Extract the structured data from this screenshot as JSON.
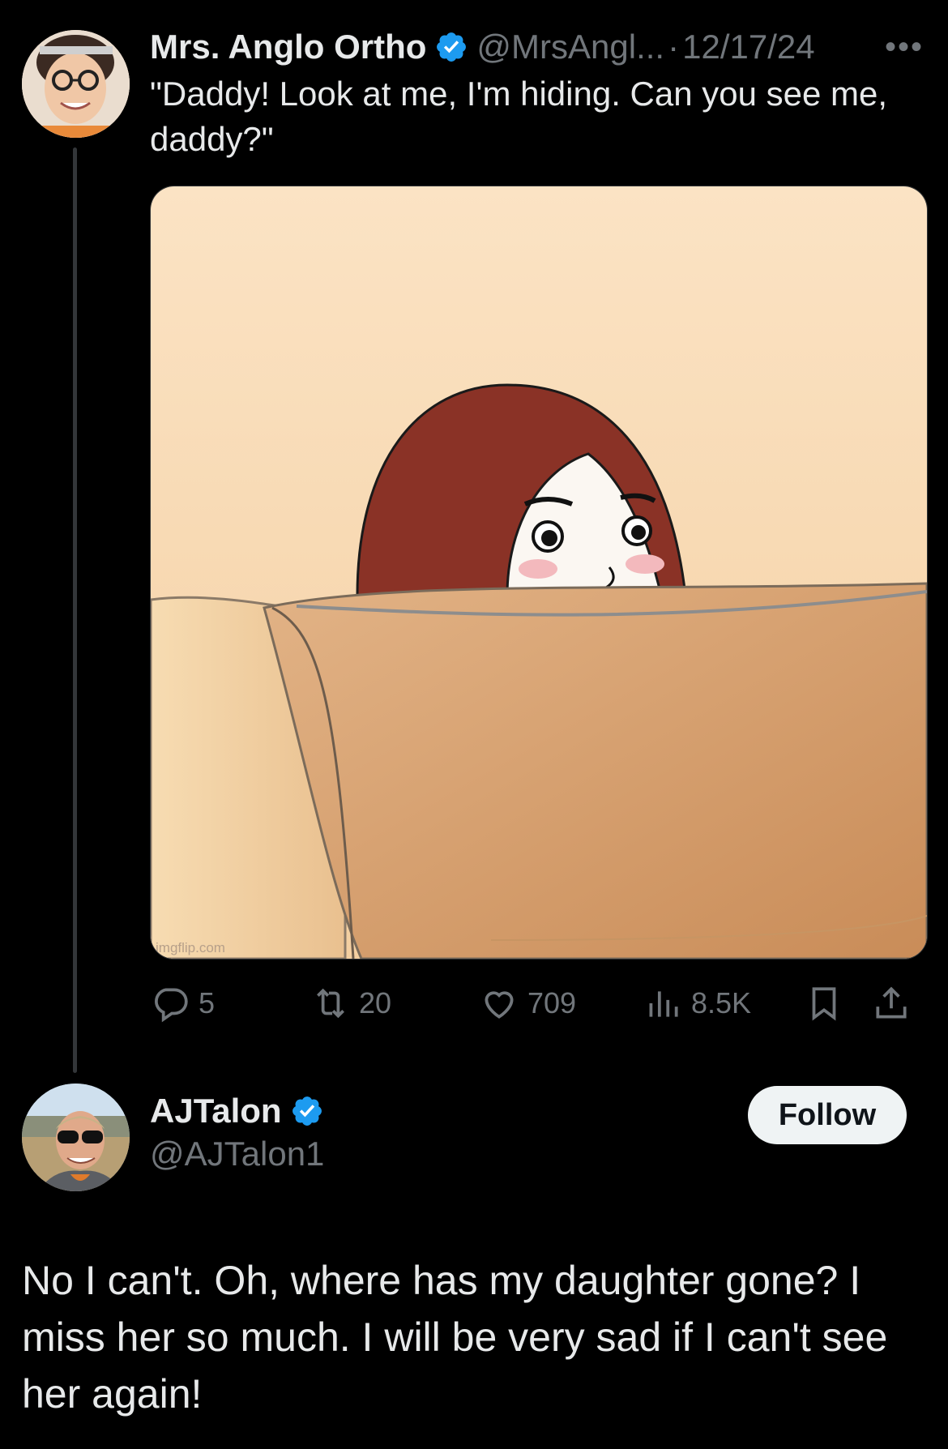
{
  "tweet": {
    "author_name": "Mrs. Anglo Ortho",
    "handle": "@MrsAngl...",
    "separator": "·",
    "date": "12/17/24",
    "more_label": "•••",
    "text": "\"Daddy! Look at me, I'm hiding. Can you see me, daddy?\"",
    "media": {
      "watermark": "imgflip.com"
    },
    "stats": {
      "replies": "5",
      "reposts": "20",
      "likes": "709",
      "views": "8.5K"
    }
  },
  "reply": {
    "author_name": "AJTalon",
    "handle": "@AJTalon1",
    "follow_label": "Follow",
    "text": "No I can't. Oh, where has my daughter gone? I miss her so much. I will be very sad if I can't see her again!"
  },
  "colors": {
    "background": "#000000",
    "text_primary": "#e7e9ea",
    "text_secondary": "#71767b",
    "verified_blue": "#1d9bf0",
    "follow_bg": "#eff3f4"
  },
  "icons": [
    "verified-badge-icon",
    "more-icon",
    "reply-icon",
    "repost-icon",
    "like-icon",
    "views-icon",
    "bookmark-icon",
    "share-icon"
  ]
}
